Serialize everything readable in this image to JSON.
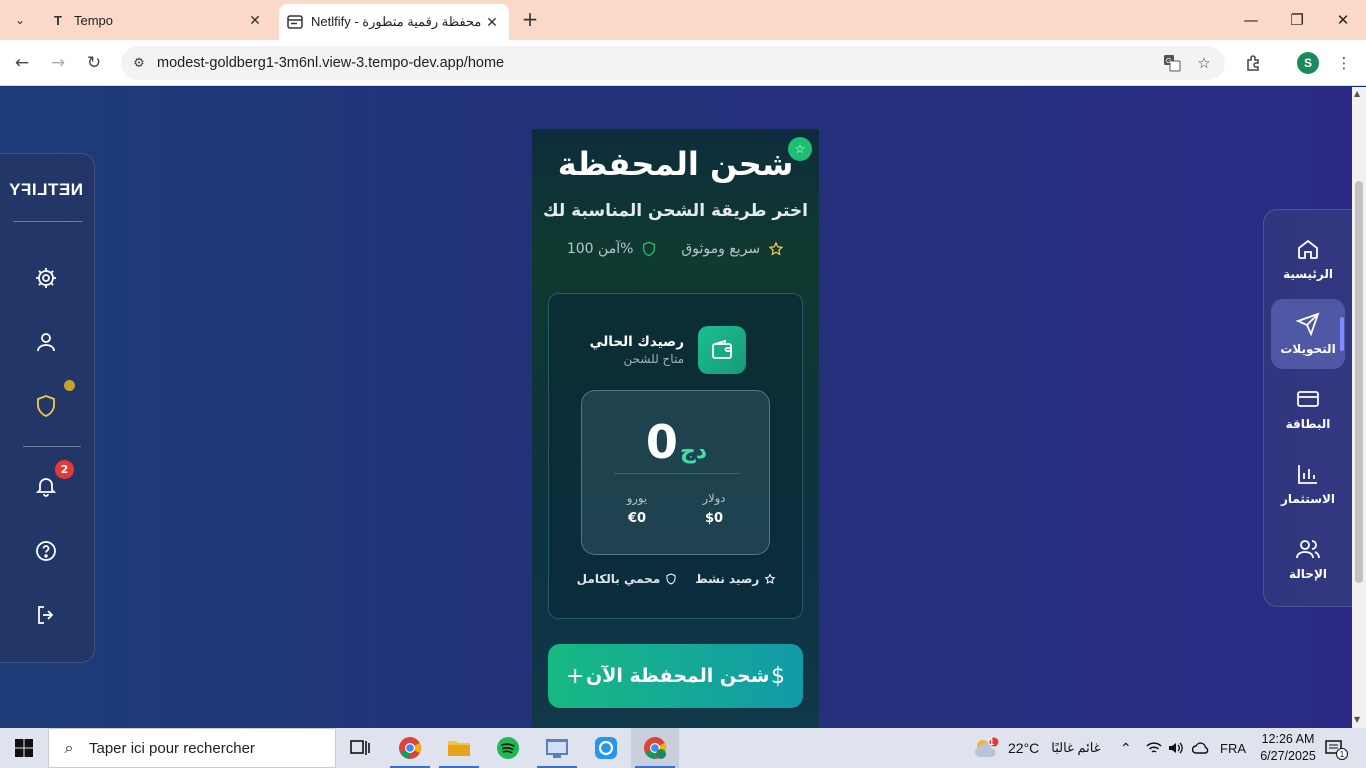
{
  "browser": {
    "tabs": [
      {
        "title": "Tempo",
        "favicon": "tempo-icon"
      },
      {
        "title": "Netlfify - محفظة رقمية متطورة",
        "favicon": "page-icon"
      }
    ],
    "url": "modest-goldberg1-3m6nl.view-3.tempo-dev.app/home",
    "profile_initial": "S"
  },
  "sidebar": {
    "brand": "NETLIFY",
    "notification_count": "2",
    "icons": [
      "gear-icon",
      "user-icon",
      "shield-icon",
      "bell-icon",
      "help-icon",
      "logout-icon"
    ]
  },
  "wallet": {
    "title": "شحن المحفظة",
    "subtitle": "اختر طريقة الشحن المناسبة لك",
    "features": [
      {
        "label": "سريع وموثوق",
        "icon": "star-icon"
      },
      {
        "label": "%آمن 100",
        "icon": "shield-icon"
      }
    ],
    "balance": {
      "title": "رصيدك الحالي",
      "subtitle": "متاح للشحن",
      "currency": "دج",
      "amount": "0",
      "dollar_label": "دولار",
      "dollar_value": "$0",
      "euro_label": "يورو",
      "euro_value": "€0",
      "status_active": "رصيد نشط",
      "status_protected": "محمي بالكامل"
    },
    "charge_button": "شحن المحفظة الآن",
    "accent": "#17b982"
  },
  "right_nav": {
    "items": [
      {
        "label": "الرئيسية",
        "icon": "home-icon"
      },
      {
        "label": "التحويلات",
        "icon": "send-icon",
        "active": true
      },
      {
        "label": "البطاقة",
        "icon": "card-icon"
      },
      {
        "label": "الاستثمار",
        "icon": "chart-icon"
      },
      {
        "label": "الإحالة",
        "icon": "users-icon"
      }
    ]
  },
  "taskbar": {
    "search_placeholder": "Taper ici pour rechercher",
    "weather_temp": "22°C",
    "weather_text": "غائم غالبًا",
    "weather_badge": "1",
    "language": "FRA",
    "time": "12:26 AM",
    "date": "6/27/2025",
    "notification_count": "1"
  }
}
